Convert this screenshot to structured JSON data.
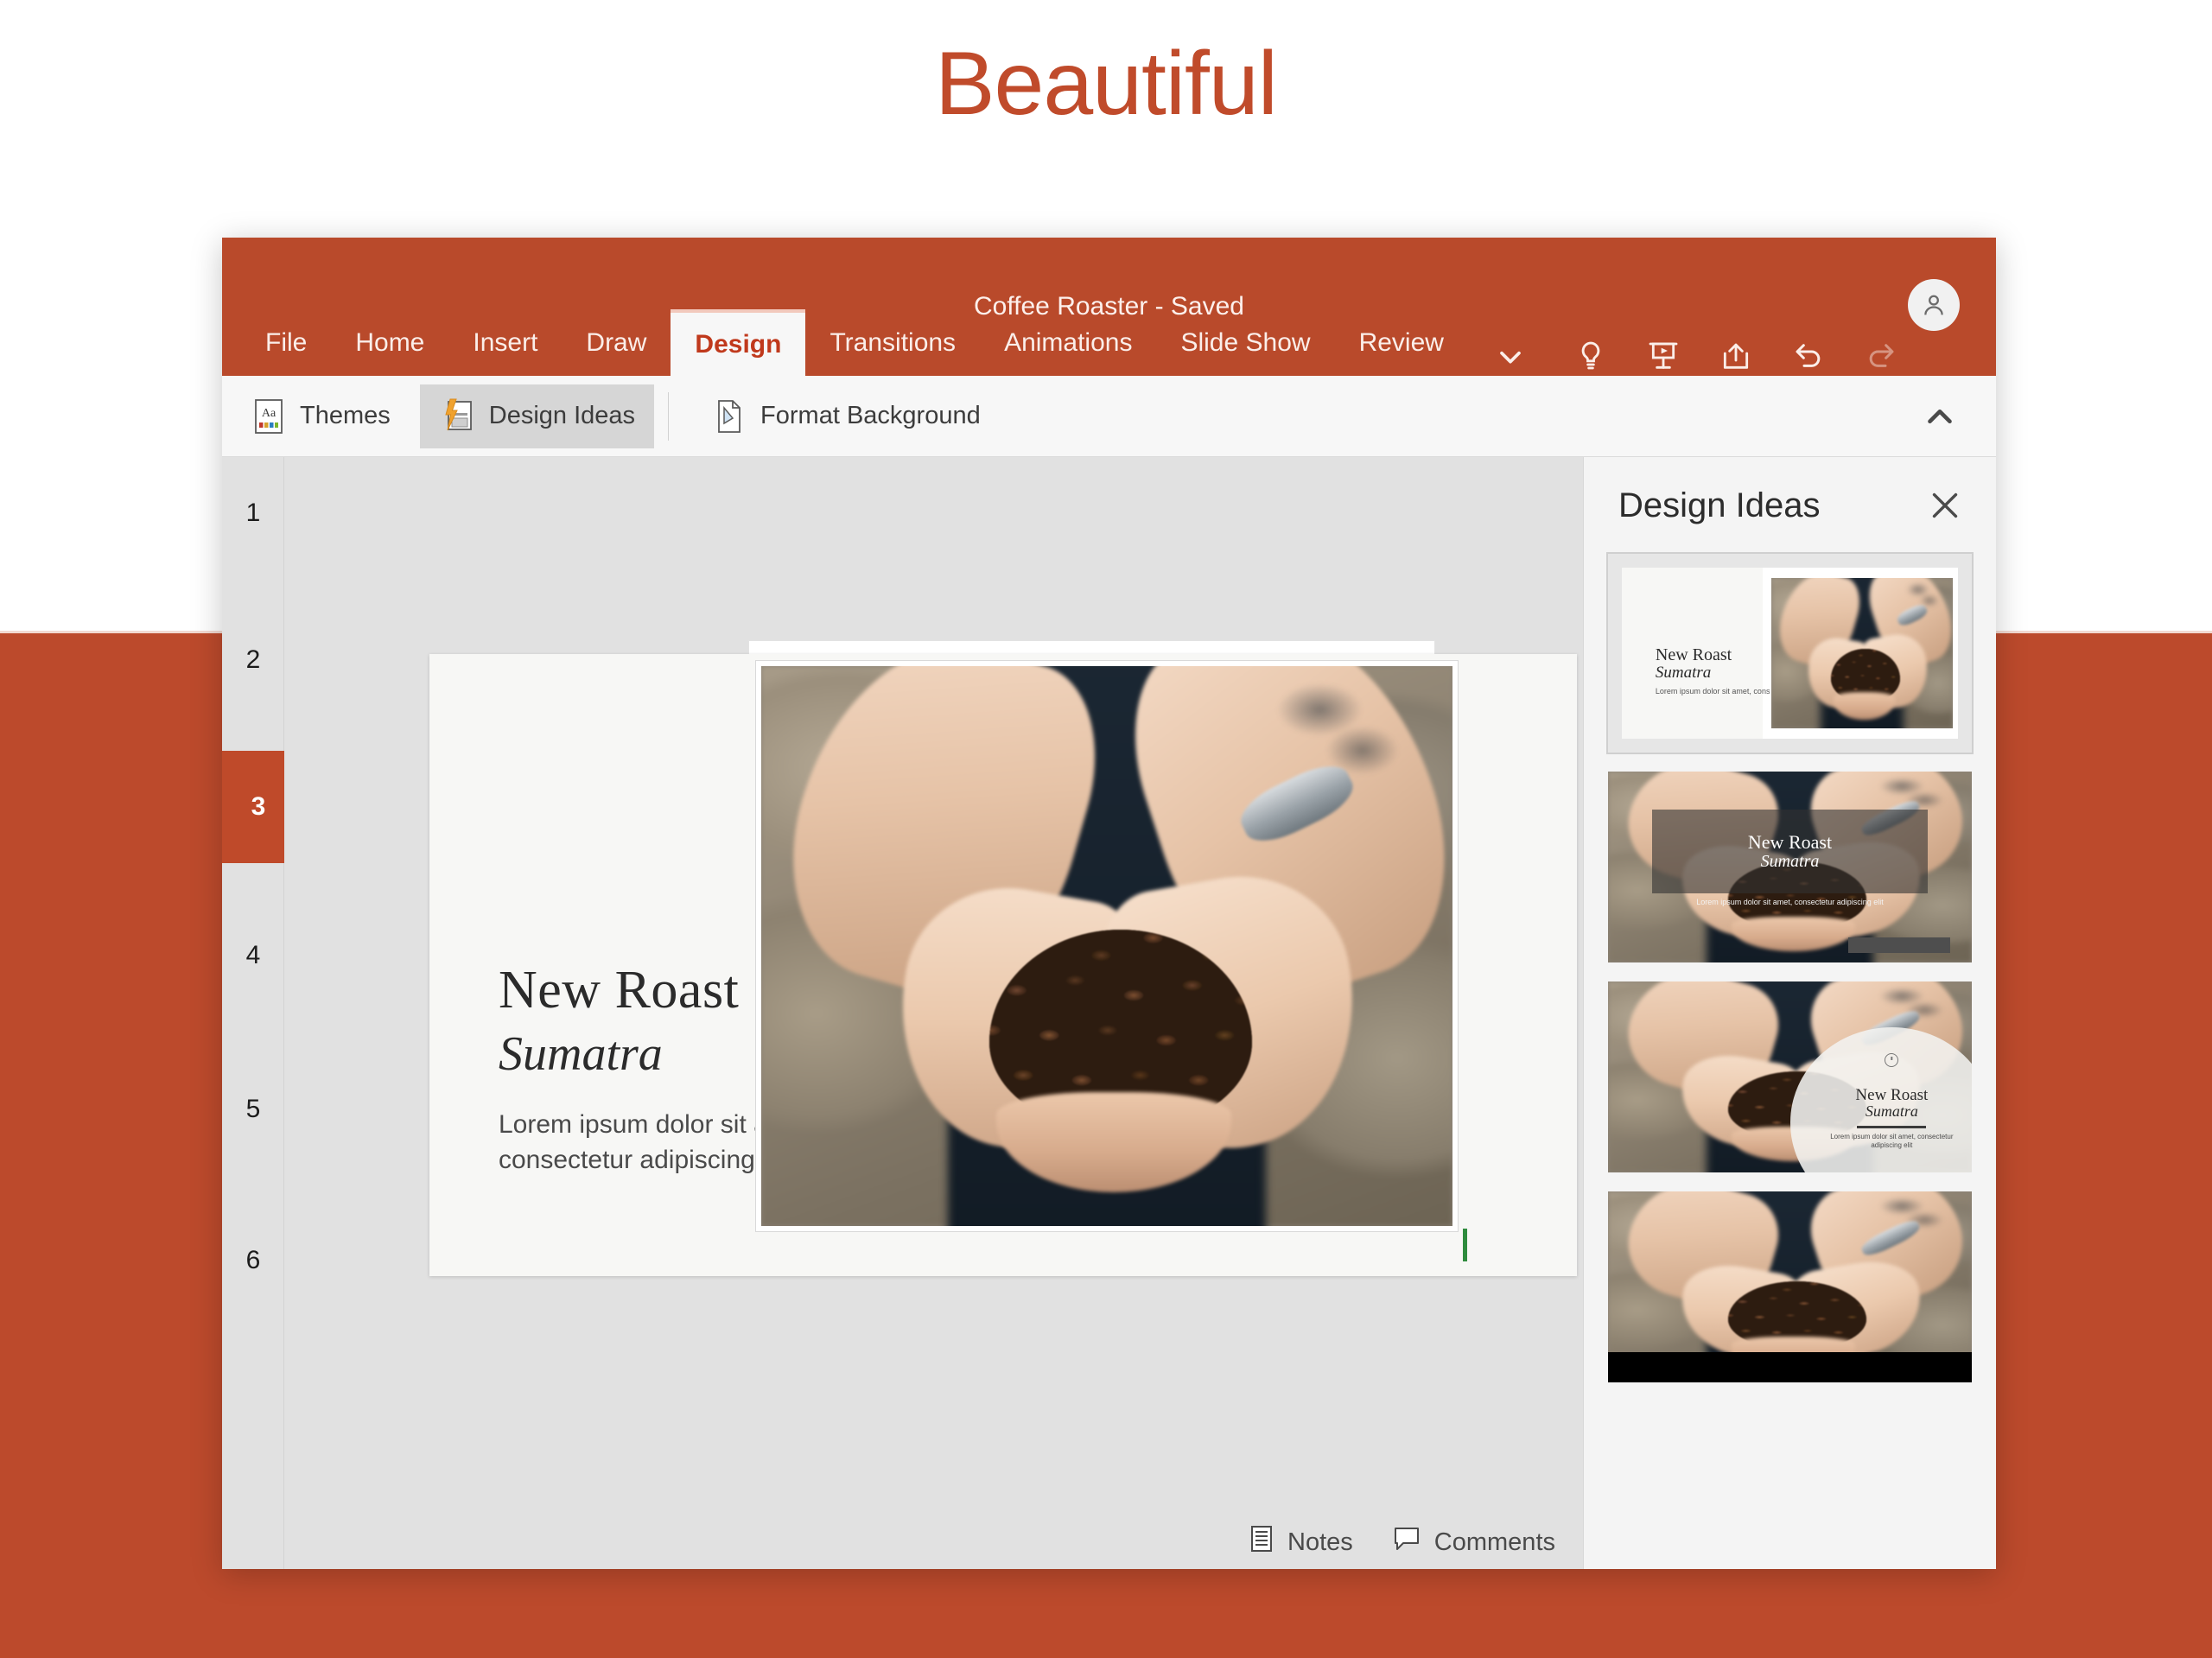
{
  "hero": {
    "headline": "Beautiful"
  },
  "window": {
    "title": "Coffee Roaster - Saved",
    "avatar_icon": "user-account-icon"
  },
  "tabs": [
    {
      "label": "File",
      "active": false
    },
    {
      "label": "Home",
      "active": false
    },
    {
      "label": "Insert",
      "active": false
    },
    {
      "label": "Draw",
      "active": false
    },
    {
      "label": "Design",
      "active": true
    },
    {
      "label": "Transitions",
      "active": false
    },
    {
      "label": "Animations",
      "active": false
    },
    {
      "label": "Slide Show",
      "active": false
    },
    {
      "label": "Review",
      "active": false
    }
  ],
  "titlebar_icons": [
    {
      "name": "chevron-down-icon",
      "label": "More tabs"
    },
    {
      "name": "lightbulb-icon",
      "label": "Tell me what you want to do"
    },
    {
      "name": "present-icon",
      "label": "Present"
    },
    {
      "name": "share-icon",
      "label": "Share"
    },
    {
      "name": "undo-icon",
      "label": "Undo"
    },
    {
      "name": "redo-icon",
      "label": "Redo"
    }
  ],
  "ribbon": {
    "buttons": [
      {
        "label": "Themes",
        "icon": "themes-icon",
        "selected": false
      },
      {
        "label": "Design Ideas",
        "icon": "design-ideas-icon",
        "selected": true
      },
      {
        "label": "Format Background",
        "icon": "format-background-icon",
        "selected": false
      }
    ],
    "collapse_icon": "chevron-up-icon"
  },
  "slide_rail": {
    "slides": [
      {
        "number": "1",
        "active": false
      },
      {
        "number": "2",
        "active": false
      },
      {
        "number": "3",
        "active": true
      },
      {
        "number": "4",
        "active": false
      },
      {
        "number": "5",
        "active": false
      },
      {
        "number": "6",
        "active": false
      }
    ]
  },
  "slide": {
    "title": "New Roast",
    "subtitle": "Sumatra",
    "body_line1": "Lorem ipsum dolor sit amet,",
    "body_line2": "consectetur adipiscing elit",
    "image_alt": "hands-holding-coffee-beans-photo"
  },
  "statusbar": {
    "notes_label": "Notes",
    "notes_icon": "notes-icon",
    "comments_label": "Comments",
    "comments_icon": "comment-bubble-icon"
  },
  "design_pane": {
    "title": "Design Ideas",
    "close_icon": "close-icon",
    "ideas": [
      {
        "name": "idea-split-image-right",
        "selected": true,
        "title": "New Roast",
        "subtitle": "Sumatra",
        "body": "Lorem ipsum dolor sit amet, consectetur adipiscing elit"
      },
      {
        "name": "idea-full-bleed-scrim",
        "selected": false,
        "title": "New Roast",
        "subtitle": "Sumatra",
        "body": "Lorem ipsum dolor sit amet, consectetur adipiscing elit"
      },
      {
        "name": "idea-circle-callout",
        "selected": false,
        "title": "New Roast",
        "subtitle": "Sumatra",
        "body": "Lorem ipsum dolor sit amet, consectetur adipiscing elit"
      },
      {
        "name": "idea-cropped-band",
        "selected": false,
        "title": "",
        "subtitle": "",
        "body": ""
      }
    ]
  },
  "colors": {
    "brand_red": "#bc4a2c",
    "titlebar_red": "#b94a2b",
    "active_tab_text": "#c0391c",
    "hero_text": "#c04b2b",
    "ribbon_bg": "#f7f7f7",
    "workspace_gray": "#e1e1e1",
    "pane_bg": "#f4f4f4"
  }
}
